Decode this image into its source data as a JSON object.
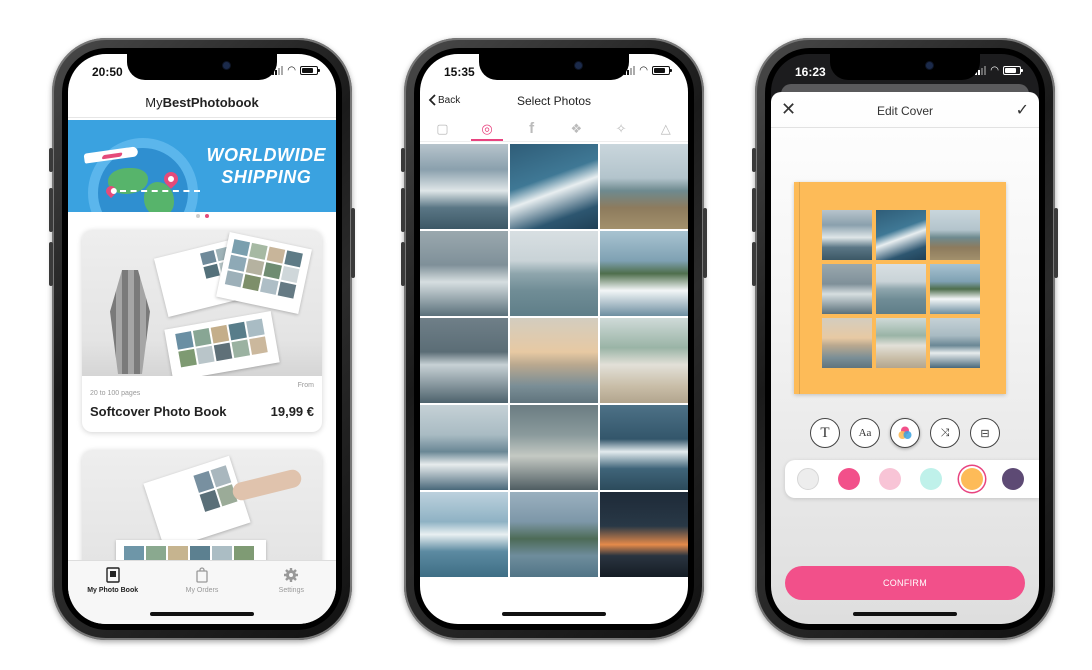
{
  "phone1": {
    "status": {
      "time": "20:50"
    },
    "app_title_prefix": "My",
    "app_title_bold": "BestPhotobook",
    "banner": {
      "line1": "WORLDWIDE",
      "line2": "SHIPPING"
    },
    "products": [
      {
        "pages": "20 to 100 pages",
        "from": "From",
        "name": "Softcover Photo Book",
        "price": "19,99 €"
      }
    ],
    "tabs": [
      {
        "label": "My Photo Book",
        "icon": "photo-book-icon",
        "active": true
      },
      {
        "label": "My Orders",
        "icon": "shopping-bag-icon",
        "active": false
      },
      {
        "label": "Settings",
        "icon": "gear-icon",
        "active": false
      }
    ]
  },
  "phone2": {
    "status": {
      "time": "15:35"
    },
    "back_label": "Back",
    "title": "Select Photos",
    "sources": [
      {
        "icon": "device-photos-icon",
        "glyph": "▢",
        "active": false
      },
      {
        "icon": "instagram-icon",
        "glyph": "◎",
        "active": true
      },
      {
        "icon": "facebook-icon",
        "glyph": "f",
        "active": false
      },
      {
        "icon": "dropbox-icon",
        "glyph": "❖",
        "active": false
      },
      {
        "icon": "flickr-icon",
        "glyph": "✧",
        "active": false
      },
      {
        "icon": "google-drive-icon",
        "glyph": "△",
        "active": false
      }
    ]
  },
  "phone3": {
    "status": {
      "time": "16:23"
    },
    "title": "Edit Cover",
    "close_glyph": "✕",
    "done_glyph": "✓",
    "cover_color": "#fdbb58",
    "tools": [
      {
        "icon": "text-icon",
        "glyph": "T"
      },
      {
        "icon": "font-icon",
        "glyph": "Aa"
      },
      {
        "icon": "color-palette-icon",
        "glyph": ""
      },
      {
        "icon": "shuffle-icon",
        "glyph": "⤨"
      },
      {
        "icon": "layout-icon",
        "glyph": "⊟"
      }
    ],
    "swatches": [
      "#ededed",
      "#f2508a",
      "#f8c4d6",
      "#bff1ea",
      "#fdbb58",
      "#5d4a74"
    ],
    "selected_swatch": 4,
    "confirm_label": "CONFIRM"
  }
}
